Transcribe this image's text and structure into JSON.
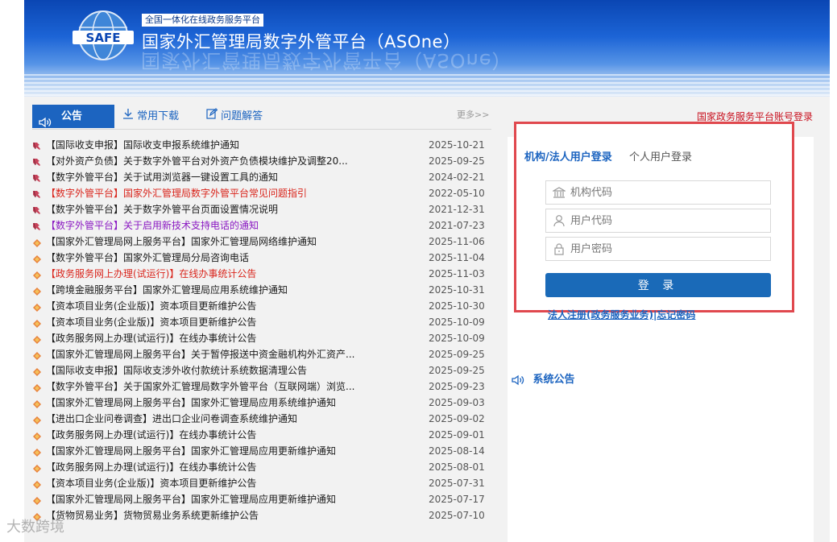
{
  "header": {
    "logo_text": "SAFE",
    "subtitle": "全国一体化在线政务服务平台",
    "title": "国家外汇管理局数字外管平台（ASOne）"
  },
  "tabs": {
    "announcement": "公告",
    "downloads": "常用下载",
    "faq": "问题解答",
    "more": "更多>>"
  },
  "notices": [
    {
      "text": "【国际收支申报】国际收支申报系统维护通知",
      "date": "2025-10-21",
      "color": "normal",
      "icon": "pin-icon"
    },
    {
      "text": "【对外资产负债】关于数字外管平台对外资产负债模块维护及调整20...",
      "date": "2025-09-25",
      "color": "normal",
      "icon": "pin-icon"
    },
    {
      "text": "【数字外管平台】关于试用浏览器一键设置工具的通知",
      "date": "2024-02-21",
      "color": "normal",
      "icon": "pin-icon"
    },
    {
      "text": "【数字外管平台】国家外汇管理局数字外管平台常见问题指引",
      "date": "2022-05-10",
      "color": "red",
      "icon": "pin-icon"
    },
    {
      "text": "【数字外管平台】关于数字外管平台页面设置情况说明",
      "date": "2021-12-31",
      "color": "normal",
      "icon": "pin-icon"
    },
    {
      "text": "【数字外管平台】关于启用新技术支持电话的通知",
      "date": "2021-07-23",
      "color": "purple",
      "icon": "pin-icon"
    },
    {
      "text": "【国家外汇管理局网上服务平台】国家外汇管理局网络维护通知",
      "date": "2025-11-06",
      "color": "normal",
      "icon": "diamond-icon"
    },
    {
      "text": "【数字外管平台】国家外汇管理局分局咨询电话",
      "date": "2025-11-04",
      "color": "normal",
      "icon": "diamond-icon"
    },
    {
      "text": "【政务服务网上办理(试运行)】在线办事统计公告",
      "date": "2025-11-03",
      "color": "red",
      "icon": "diamond-icon"
    },
    {
      "text": "【跨境金融服务平台】国家外汇管理局应用系统维护通知",
      "date": "2025-10-31",
      "color": "normal",
      "icon": "diamond-icon"
    },
    {
      "text": "【资本项目业务(企业版)】资本项目更新维护公告",
      "date": "2025-10-30",
      "color": "normal",
      "icon": "diamond-icon"
    },
    {
      "text": "【资本项目业务(企业版)】资本项目更新维护公告",
      "date": "2025-10-09",
      "color": "normal",
      "icon": "diamond-icon"
    },
    {
      "text": "【政务服务网上办理(试运行)】在线办事统计公告",
      "date": "2025-10-09",
      "color": "normal",
      "icon": "diamond-icon"
    },
    {
      "text": "【国家外汇管理局网上服务平台】关于暂停报送中资金融机构外汇资产...",
      "date": "2025-09-25",
      "color": "normal",
      "icon": "diamond-icon"
    },
    {
      "text": "【国际收支申报】国际收支涉外收付款统计系统数据清理公告",
      "date": "2025-09-25",
      "color": "normal",
      "icon": "diamond-icon"
    },
    {
      "text": "【数字外管平台】关于国家外汇管理局数字外管平台（互联网端）浏览...",
      "date": "2025-09-23",
      "color": "normal",
      "icon": "diamond-icon"
    },
    {
      "text": "【国家外汇管理局网上服务平台】国家外汇管理局应用系统维护通知",
      "date": "2025-09-03",
      "color": "normal",
      "icon": "diamond-icon"
    },
    {
      "text": "【进出口企业问卷调查】进出口企业问卷调查系统维护通知",
      "date": "2025-09-02",
      "color": "normal",
      "icon": "diamond-icon"
    },
    {
      "text": "【政务服务网上办理(试运行)】在线办事统计公告",
      "date": "2025-09-01",
      "color": "normal",
      "icon": "diamond-icon"
    },
    {
      "text": "【国家外汇管理局网上服务平台】国家外汇管理局应用更新维护通知",
      "date": "2025-08-14",
      "color": "normal",
      "icon": "diamond-icon"
    },
    {
      "text": "【政务服务网上办理(试运行)】在线办事统计公告",
      "date": "2025-08-01",
      "color": "normal",
      "icon": "diamond-icon"
    },
    {
      "text": "【资本项目业务(企业版)】资本项目更新维护公告",
      "date": "2025-07-31",
      "color": "normal",
      "icon": "diamond-icon"
    },
    {
      "text": "【国家外汇管理局网上服务平台】国家外汇管理局应用更新维护通知",
      "date": "2025-07-17",
      "color": "normal",
      "icon": "diamond-icon"
    },
    {
      "text": "【货物贸易业务】货物贸易业务系统更新维护公告",
      "date": "2025-07-10",
      "color": "normal",
      "icon": "diamond-icon"
    }
  ],
  "login": {
    "gov_link": "国家政务服务平台账号登录",
    "tab_org": "机构/法人用户登录",
    "tab_personal": "个人用户登录",
    "org_code_placeholder": "机构代码",
    "user_code_placeholder": "用户代码",
    "password_placeholder": "用户密码",
    "submit": "登 录",
    "register_link": "法人注册(政务服务业务)",
    "separator": "|",
    "forgot_link": "忘记密码"
  },
  "system_notice": {
    "title": "系统公告"
  },
  "watermark": "大数跨境",
  "colors": {
    "brand_blue": "#1c64c0",
    "highlight_red": "#d9251c",
    "purple": "#8a18c2",
    "login_border": "#e0484e",
    "button_blue": "#1a6ab8"
  }
}
